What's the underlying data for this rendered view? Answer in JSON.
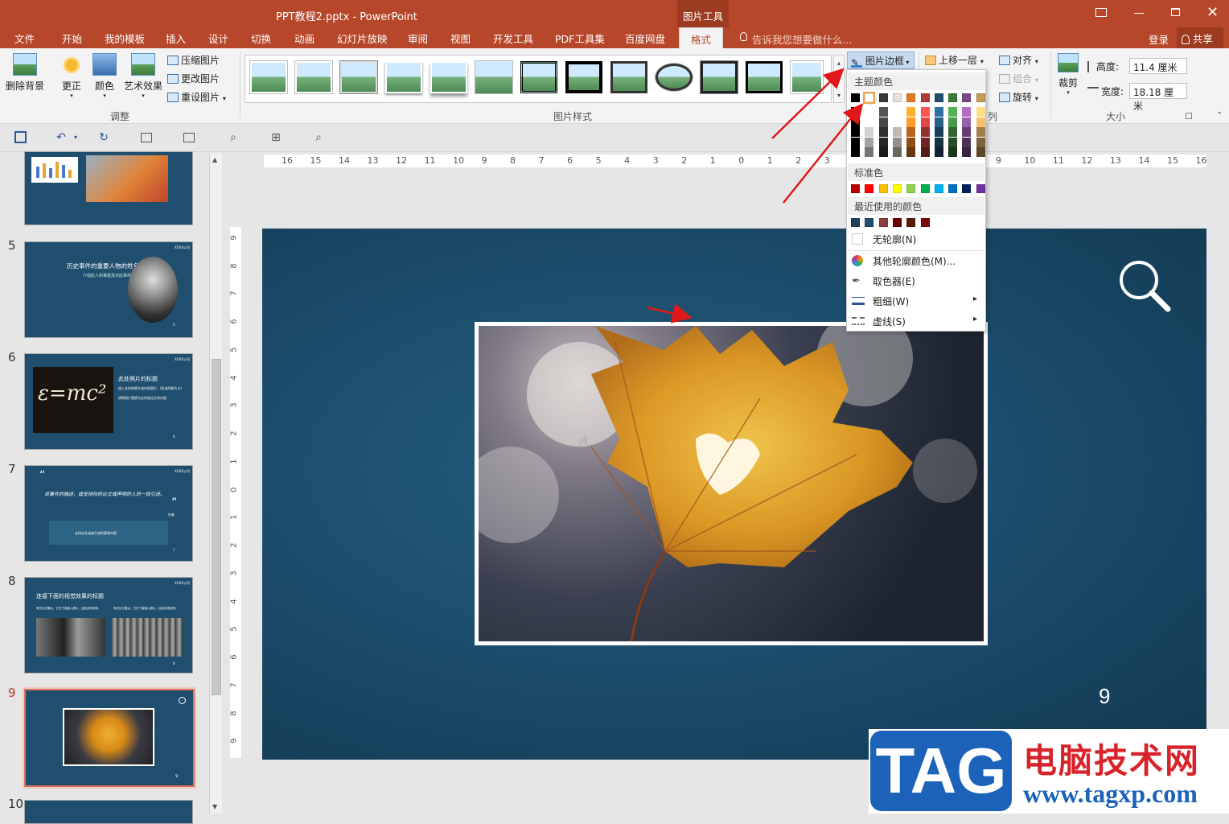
{
  "window": {
    "title": "PPT教程2.pptx - PowerPoint",
    "context_tool": "图片工具",
    "tell_me": "告诉我您想要做什么...",
    "signin": "登录",
    "share": "共享"
  },
  "tabs": [
    "文件",
    "开始",
    "我的模板",
    "插入",
    "设计",
    "切换",
    "动画",
    "幻灯片放映",
    "审阅",
    "视图",
    "开发工具",
    "PDF工具集",
    "百度网盘",
    "格式"
  ],
  "active_tab": "格式",
  "ribbon": {
    "adjust": {
      "remove_bg": "删除背景",
      "corrections": "更正",
      "color": "颜色",
      "artistic": "艺术效果",
      "compress": "压缩图片",
      "change": "更改图片",
      "reset": "重设图片",
      "group_label": "调整"
    },
    "styles_group_label": "图片样式",
    "border_button": "图片边框",
    "arrange": {
      "bring_forward": "上移一层",
      "align": "对齐",
      "group": "组合",
      "rotate": "旋转",
      "group_label_fragment": "列"
    },
    "size": {
      "crop": "裁剪",
      "height_label": "高度:",
      "height_value": "11.4 厘米",
      "width_label": "宽度:",
      "width_value": "18.18 厘米",
      "group_label": "大小"
    }
  },
  "ruler": {
    "h_ticks": [
      "16",
      "15",
      "14",
      "13",
      "12",
      "11",
      "10",
      "9",
      "8",
      "7",
      "6",
      "5",
      "4",
      "3",
      "2",
      "1",
      "0",
      "1",
      "2",
      "3",
      "4",
      "5",
      "6",
      "7",
      "8",
      "9",
      "10",
      "11",
      "12",
      "13",
      "14",
      "15",
      "16"
    ],
    "v_ticks": [
      "9",
      "8",
      "7",
      "6",
      "5",
      "4",
      "3",
      "2",
      "1",
      "0",
      "1",
      "2",
      "3",
      "4",
      "5",
      "6",
      "7",
      "8",
      "9"
    ]
  },
  "thumbnails": [
    {
      "num": "",
      "texts": []
    },
    {
      "num": "5",
      "texts": [
        "历史事件的重要人物的姓名",
        "介绍此人的事迹及对此事件的影响。",
        "XXXX公司",
        "5"
      ]
    },
    {
      "num": "6",
      "texts": [
        "此处照片的标题",
        "插入支持的照片或内容图片，(所选的照片与)",
        "请将照片替换为支持您论文的内容",
        "XXXX公司",
        "6"
      ]
    },
    {
      "num": "7",
      "texts": [
        "“",
        "该事件的描述，或支持你的论文或声明的人的一段引述。",
        "”",
        "作者",
        "支持论文或者引述的客观内容",
        "XXXX公司",
        "7"
      ]
    },
    {
      "num": "8",
      "texts": [
        "连接下面的视觉效果的标题",
        "有关论文要点，它在下面插入图片，此处用来说明，",
        "有关论文要点，它在下面插入图片，此处用来说明，",
        "XXXX公司",
        "8"
      ]
    },
    {
      "num": "9",
      "texts": [
        "9"
      ]
    },
    {
      "num": "10",
      "texts": []
    }
  ],
  "slide": {
    "page_number": "9"
  },
  "dropdown": {
    "theme_colors_label": "主题颜色",
    "theme_row": [
      "#000000",
      "#ffffff",
      "#3a3a3a",
      "#e7e1d8",
      "#e07a22",
      "#b43a3a",
      "#1f4e6e",
      "#3a7a3a",
      "#7a4b8a",
      "#c59a5a"
    ],
    "standard_label": "标准色",
    "standard_colors": [
      "#c00000",
      "#ff0000",
      "#ffc000",
      "#ffff00",
      "#92d050",
      "#00b050",
      "#00b0f0",
      "#0070c0",
      "#002060",
      "#7030a0"
    ],
    "recent_label": "最近使用的颜色",
    "recent_colors": [
      "#1f3f5a",
      "#1f4e6e",
      "#8b4040",
      "#6b0000",
      "#5a1a0a",
      "#7a0a0a"
    ],
    "no_outline": "无轮廓(N)",
    "more_colors": "其他轮廓颜色(M)...",
    "eyedropper": "取色器(E)",
    "weight": "粗细(W)",
    "dashes": "虚线(S)"
  },
  "watermark": {
    "tag": "TAG",
    "cn": "电脑技术网",
    "url": "www.tagxp.com"
  },
  "colors": {
    "accent": "#b7472a",
    "slide_bg": "#1b4a69",
    "annotation": "#e01818"
  }
}
